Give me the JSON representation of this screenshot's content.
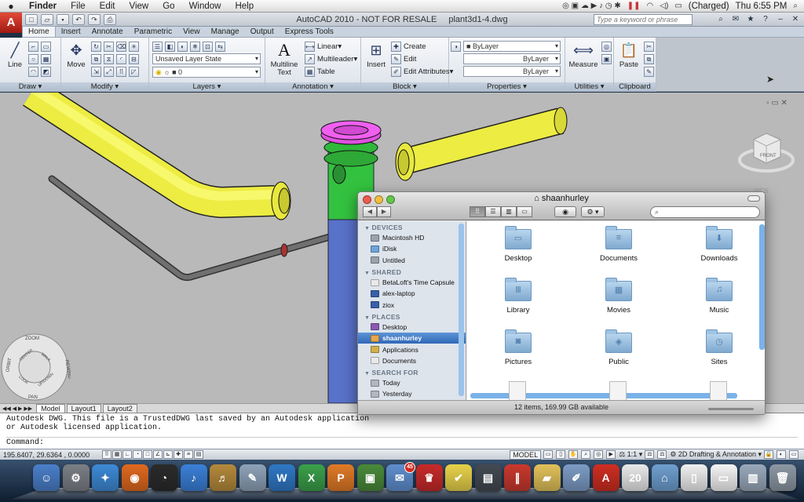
{
  "menubar": {
    "items": [
      "Finder",
      "File",
      "Edit",
      "View",
      "Go",
      "Window",
      "Help"
    ],
    "battery_status": "(Charged)",
    "clock": "Thu 6:55 PM"
  },
  "acad": {
    "logo": "A",
    "title_app": "AutoCAD 2010 - NOT FOR RESALE",
    "title_file": "plant3d1-4.dwg",
    "search_placeholder": "Type a keyword or phrase",
    "tabs": [
      "Home",
      "Insert",
      "Annotate",
      "Parametric",
      "View",
      "Manage",
      "Output",
      "Express Tools"
    ],
    "active_tab": "Home"
  },
  "ribbon": {
    "draw": {
      "title": "Draw",
      "line": "Line"
    },
    "modify": {
      "title": "Modify",
      "move": "Move"
    },
    "layers": {
      "title": "Layers",
      "state": "Unsaved Layer State",
      "layer": "0"
    },
    "annotation": {
      "title": "Annotation",
      "mtext": "Multiline Text",
      "linear": "Linear",
      "multileader": "Multileader",
      "table": "Table"
    },
    "block": {
      "title": "Block",
      "insert": "Insert",
      "create": "Create",
      "edit": "Edit",
      "edit_attributes": "Edit Attributes"
    },
    "properties": {
      "title": "Properties",
      "color": "ByLayer",
      "linetype": "ByLayer",
      "lineweight": "ByLayer"
    },
    "utilities": {
      "title": "Utilities",
      "measure": "Measure"
    },
    "clipboard": {
      "title": "Clipboard",
      "paste": "Paste"
    }
  },
  "viewcube": {
    "face": "FRONT",
    "wcs": "WCS"
  },
  "navwheel": {
    "zoom": "ZOOM",
    "orbit": "ORBIT",
    "rewind": "REWIND",
    "pan": "PAN",
    "center": "CENTER",
    "walk": "WALK",
    "look": "LOOK",
    "updown": "UP/DOWN"
  },
  "layout_tabs": [
    "Model",
    "Layout1",
    "Layout2"
  ],
  "command": {
    "line1": "Autodesk DWG.  This file is a TrustedDWG last saved by an Autodesk application",
    "line2": "or Autodesk licensed application.",
    "prompt": "Command:"
  },
  "statusbar": {
    "coords": "195.6407, 29.6364 , 0.0000",
    "model": "MODEL",
    "scale": "1:1",
    "workspace": "2D Drafting & Annotation"
  },
  "finder": {
    "title": "shaanhurley",
    "search_placeholder": "",
    "sidebar": [
      {
        "type": "head",
        "label": "DEVICES"
      },
      {
        "type": "item",
        "label": "Macintosh HD",
        "color": "#9aa3ad"
      },
      {
        "type": "item",
        "label": "iDisk",
        "color": "#6fa4d8"
      },
      {
        "type": "item",
        "label": "Untitled",
        "color": "#9aa3ad"
      },
      {
        "type": "head",
        "label": "SHARED"
      },
      {
        "type": "item",
        "label": "BetaLoft's Time Capsule",
        "color": "#e9e9e9"
      },
      {
        "type": "item",
        "label": "alex-laptop",
        "color": "#3a5fa8"
      },
      {
        "type": "item",
        "label": "ziox",
        "color": "#3a5fa8"
      },
      {
        "type": "head",
        "label": "PLACES"
      },
      {
        "type": "item",
        "label": "Desktop",
        "color": "#8a5ab0"
      },
      {
        "type": "item",
        "label": "shaanhurley",
        "color": "#e7a64a",
        "selected": true
      },
      {
        "type": "item",
        "label": "Applications",
        "color": "#d1b04a"
      },
      {
        "type": "item",
        "label": "Documents",
        "color": "#e9e9e9"
      },
      {
        "type": "head",
        "label": "SEARCH FOR"
      },
      {
        "type": "item",
        "label": "Today",
        "color": "#b0b7c0"
      },
      {
        "type": "item",
        "label": "Yesterday",
        "color": "#b0b7c0"
      }
    ],
    "folders": [
      {
        "label": "Desktop",
        "glyph": "▭"
      },
      {
        "label": "Documents",
        "glyph": "≡"
      },
      {
        "label": "Downloads",
        "glyph": "⬇"
      },
      {
        "label": "Library",
        "glyph": "Ⅲ"
      },
      {
        "label": "Movies",
        "glyph": "▦"
      },
      {
        "label": "Music",
        "glyph": "♫"
      },
      {
        "label": "Pictures",
        "glyph": "◙"
      },
      {
        "label": "Public",
        "glyph": "◈"
      },
      {
        "label": "Sites",
        "glyph": "◷"
      }
    ],
    "status": "12 items, 169.99 GB available"
  },
  "dock": {
    "apps": [
      {
        "name": "finder",
        "color": "#4a7fc9",
        "glyph": "☺"
      },
      {
        "name": "system-preferences",
        "color": "#7b7f86",
        "glyph": "⚙"
      },
      {
        "name": "safari",
        "color": "#3e8ad6",
        "glyph": "✦"
      },
      {
        "name": "firefox",
        "color": "#e0691f",
        "glyph": "◉"
      },
      {
        "name": "dashboard",
        "color": "#2b2b2b",
        "glyph": "◔"
      },
      {
        "name": "itunes",
        "color": "#3b80d8",
        "glyph": "♪"
      },
      {
        "name": "garageband",
        "color": "#b48a3c",
        "glyph": "♬"
      },
      {
        "name": "script-editor",
        "color": "#8ea2b8",
        "glyph": "✎"
      },
      {
        "name": "word",
        "color": "#2f78c5",
        "glyph": "W"
      },
      {
        "name": "excel",
        "color": "#3aa04a",
        "glyph": "X"
      },
      {
        "name": "powerpoint",
        "color": "#e07a27",
        "glyph": "P"
      },
      {
        "name": "photo-app",
        "color": "#4a8a3a",
        "glyph": "▣"
      },
      {
        "name": "mail",
        "color": "#5f8fcf",
        "glyph": "✉",
        "badge": "45"
      },
      {
        "name": "chair-app",
        "color": "#c72a2a",
        "glyph": "♛"
      },
      {
        "name": "twitter-bird",
        "color": "#e8d24a",
        "glyph": "✔"
      },
      {
        "name": "media-app",
        "color": "#444a52",
        "glyph": "▤"
      },
      {
        "name": "parallels",
        "color": "#c9392e",
        "glyph": "∥"
      },
      {
        "name": "folder-app",
        "color": "#e1c15a",
        "glyph": "▰"
      },
      {
        "name": "preview",
        "color": "#7c9cc5",
        "glyph": "✐"
      },
      {
        "name": "autocad",
        "color": "#cf2e22",
        "glyph": "A"
      },
      {
        "name": "calendar",
        "color": "#e9e9e9",
        "glyph": "20"
      },
      {
        "name": "downloads-stack",
        "color": "#6f9fd0",
        "glyph": "⌂"
      },
      {
        "name": "documents-stack",
        "color": "#f0f0f0",
        "glyph": "▯"
      },
      {
        "name": "sites-stack",
        "color": "#f5f5f5",
        "glyph": "▭"
      },
      {
        "name": "screen-stack",
        "color": "#9aa9bb",
        "glyph": "▥"
      },
      {
        "name": "trash",
        "color": "#8d98a4",
        "glyph": "🗑"
      }
    ]
  }
}
